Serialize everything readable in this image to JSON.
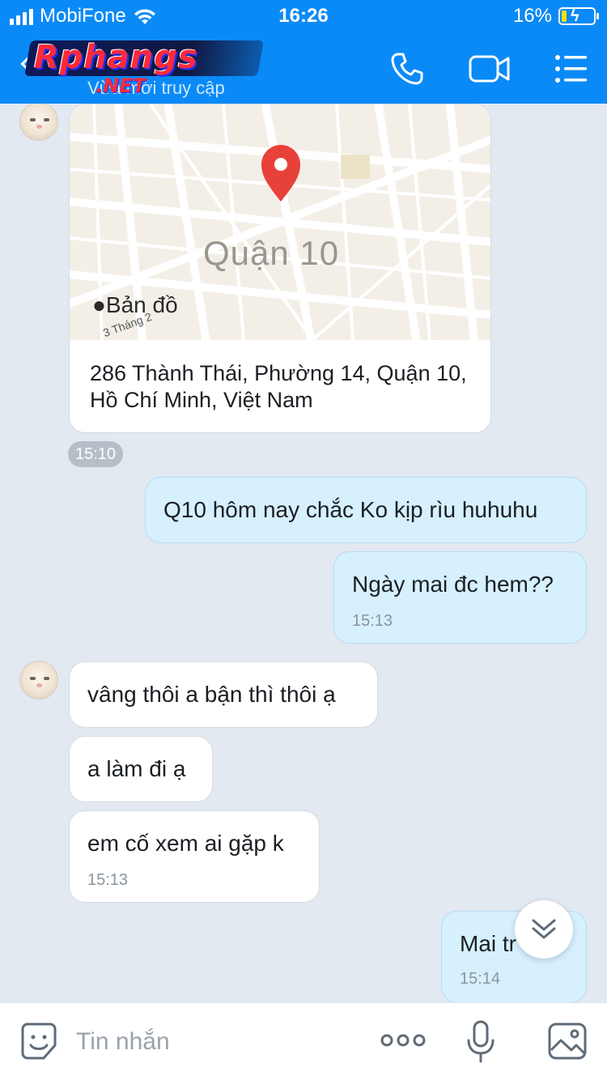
{
  "status_bar": {
    "carrier": "MobiFone",
    "time": "16:26",
    "battery_percent": "16%",
    "battery_level": 0.16,
    "signal_bars": 4
  },
  "header": {
    "logo_text": "Rphangs",
    "logo_suffix": ".NET",
    "subtitle": "Vừa mới truy cập",
    "icons": [
      "back-icon",
      "call-icon",
      "video-call-icon",
      "menu-icon"
    ]
  },
  "map_message": {
    "district_label": "Quận 10",
    "map_brand": "Bản đồ",
    "street_label": "3 Tháng 2",
    "address": "286 Thành Thái, Phường 14, Quận 10, Hồ Chí Minh, Việt Nam",
    "time": "15:10"
  },
  "messages": [
    {
      "side": "sent",
      "text": "Q10 hôm nay chắc Ko kịp rìu huhuhu",
      "time": ""
    },
    {
      "side": "sent",
      "text": "Ngày mai đc hem??",
      "time": "15:13"
    },
    {
      "side": "received",
      "text": "vâng thôi a bận thì thôi ạ",
      "time": ""
    },
    {
      "side": "received",
      "text": "a làm đi ạ",
      "time": ""
    },
    {
      "side": "received",
      "text": "em cố xem ai gặp k",
      "time": "15:13"
    },
    {
      "side": "sent",
      "text": "Mai tr",
      "time": "15:14"
    }
  ],
  "input_bar": {
    "placeholder": "Tin nhắn",
    "icons": [
      "sticker-icon",
      "more-icon",
      "microphone-icon",
      "image-icon"
    ]
  },
  "colors": {
    "header": "#0a8af7",
    "chat_background": "#e2e9f1",
    "sent_bubble": "#d6f0fe",
    "received_bubble": "#ffffff",
    "map_pin": "#e8413a"
  }
}
